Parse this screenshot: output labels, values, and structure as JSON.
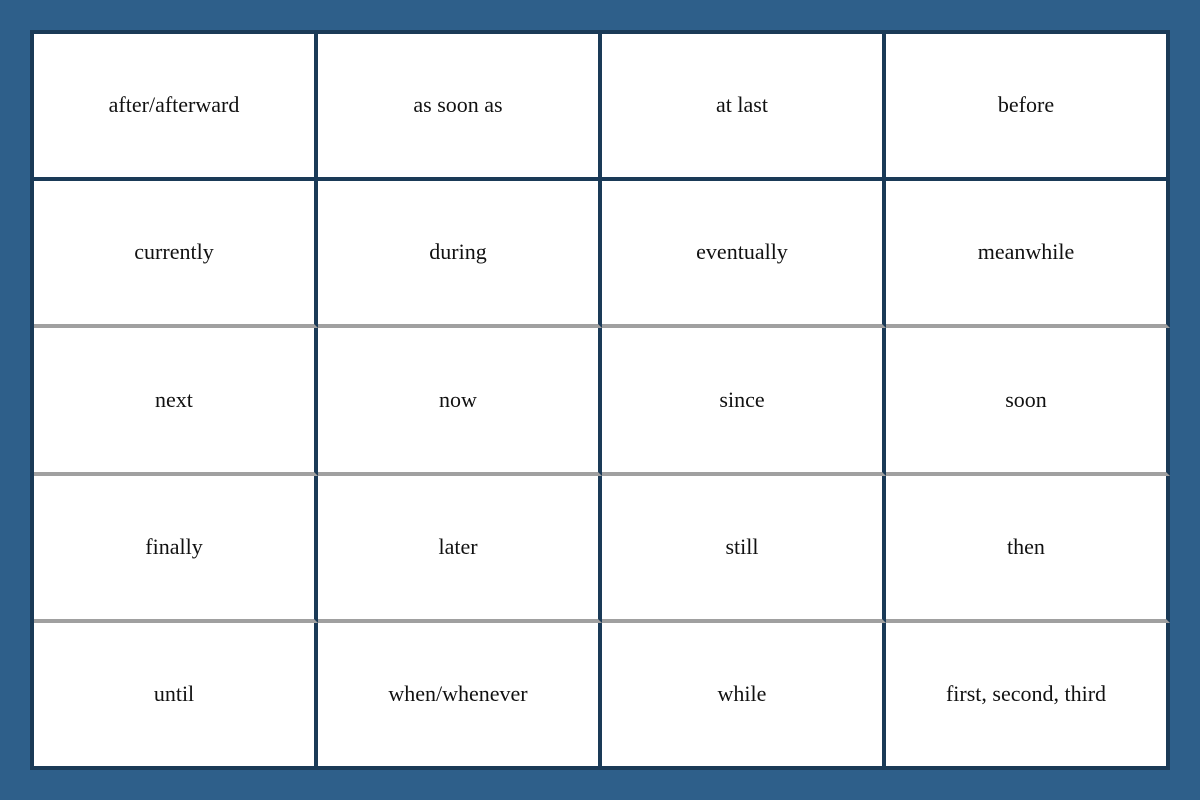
{
  "grid": {
    "cells": [
      {
        "id": "after-afterward",
        "text": "after/afterward"
      },
      {
        "id": "as-soon-as",
        "text": "as soon as"
      },
      {
        "id": "at-last",
        "text": "at last"
      },
      {
        "id": "before",
        "text": "before"
      },
      {
        "id": "currently",
        "text": "currently"
      },
      {
        "id": "during",
        "text": "during"
      },
      {
        "id": "eventually",
        "text": "eventually"
      },
      {
        "id": "meanwhile",
        "text": "meanwhile"
      },
      {
        "id": "next",
        "text": "next"
      },
      {
        "id": "now",
        "text": "now"
      },
      {
        "id": "since",
        "text": "since"
      },
      {
        "id": "soon",
        "text": "soon"
      },
      {
        "id": "finally",
        "text": "finally"
      },
      {
        "id": "later",
        "text": "later"
      },
      {
        "id": "still",
        "text": "still"
      },
      {
        "id": "then",
        "text": "then"
      },
      {
        "id": "until",
        "text": "until"
      },
      {
        "id": "when-whenever",
        "text": "when/whenever"
      },
      {
        "id": "while",
        "text": "while"
      },
      {
        "id": "first-second-third",
        "text": "first, second, third"
      }
    ]
  }
}
